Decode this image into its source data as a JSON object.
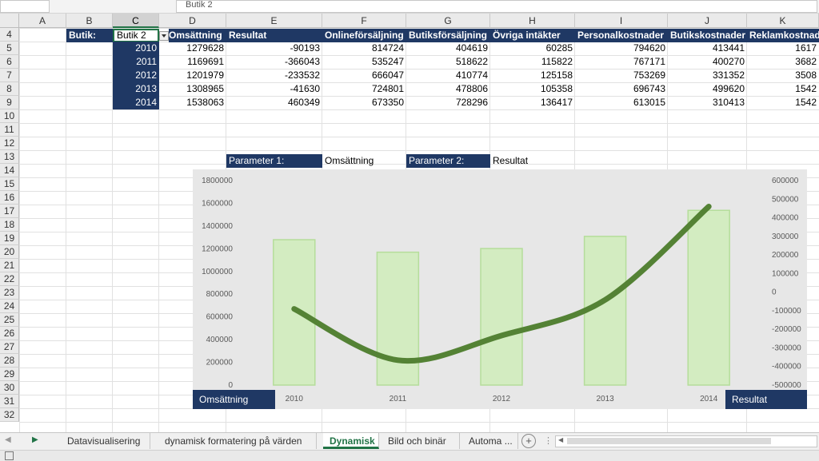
{
  "formula_bar": {
    "content": "Butik 2"
  },
  "columns": [
    "A",
    "B",
    "C",
    "D",
    "E",
    "F",
    "G",
    "H",
    "I",
    "J",
    "K"
  ],
  "rows": [
    "4",
    "5",
    "6",
    "7",
    "8",
    "9",
    "10",
    "11",
    "12",
    "13",
    "14",
    "15",
    "16",
    "17",
    "18",
    "19",
    "20",
    "21",
    "22",
    "23",
    "24",
    "25",
    "26",
    "27",
    "28",
    "29",
    "30",
    "31",
    "32"
  ],
  "store_label": "Butik:",
  "store_value": "Butik 2",
  "table": {
    "headers": [
      "Omsättning",
      "Resultat",
      "Onlineförsäljning",
      "Butiksförsäljning",
      "Övriga intäkter",
      "Personalkostnader",
      "Butikskostnader",
      "Reklamkostnader"
    ],
    "rows": [
      {
        "year": "2010",
        "values": [
          "1279628",
          "-90193",
          "814724",
          "404619",
          "60285",
          "794620",
          "413441",
          "1617"
        ]
      },
      {
        "year": "2011",
        "values": [
          "1169691",
          "-366043",
          "535247",
          "518622",
          "115822",
          "767171",
          "400270",
          "3682"
        ]
      },
      {
        "year": "2012",
        "values": [
          "1201979",
          "-233532",
          "666047",
          "410774",
          "125158",
          "753269",
          "331352",
          "3508"
        ]
      },
      {
        "year": "2013",
        "values": [
          "1308965",
          "-41630",
          "724801",
          "478806",
          "105358",
          "696743",
          "499620",
          "1542"
        ]
      },
      {
        "year": "2014",
        "values": [
          "1538063",
          "460349",
          "673350",
          "728296",
          "136417",
          "613015",
          "310413",
          "1542"
        ]
      }
    ]
  },
  "params": {
    "p1_label": "Parameter 1:",
    "p1_value": "Omsättning",
    "p2_label": "Parameter 2:",
    "p2_value": "Resultat"
  },
  "chart_data": {
    "type": "bar",
    "categories": [
      "2010",
      "2011",
      "2012",
      "2013",
      "2014"
    ],
    "series": [
      {
        "name": "Omsättning",
        "type": "bar",
        "axis": "left",
        "values": [
          1279628,
          1169691,
          1201979,
          1308965,
          1538063
        ],
        "color": "#d3ecc1"
      },
      {
        "name": "Resultat",
        "type": "line",
        "axis": "right",
        "values": [
          -90193,
          -366043,
          -233532,
          -41630,
          460349
        ],
        "color": "#548235"
      }
    ],
    "ylim_left": [
      0,
      1800000
    ],
    "yticks_left": [
      "0",
      "200000",
      "400000",
      "600000",
      "800000",
      "1000000",
      "1200000",
      "1400000",
      "1600000",
      "1800000"
    ],
    "ylim_right": [
      -500000,
      600000
    ],
    "yticks_right": [
      "-500000",
      "-400000",
      "-300000",
      "-200000",
      "-100000",
      "0",
      "100000",
      "200000",
      "300000",
      "400000",
      "500000",
      "600000"
    ],
    "left_axis_box": "Omsättning",
    "right_axis_box": "Resultat",
    "grid": false
  },
  "sheet_tabs": [
    {
      "label": "Datavisualisering",
      "active": false
    },
    {
      "label": "dynamisk formatering på värden",
      "active": false
    },
    {
      "label": "Dynamisk",
      "active": true
    },
    {
      "label": "Bild och binär",
      "active": false
    },
    {
      "label": "Automa ...",
      "active": false
    }
  ],
  "colors": {
    "header_fill": "#1f3864",
    "accent": "#217346"
  }
}
